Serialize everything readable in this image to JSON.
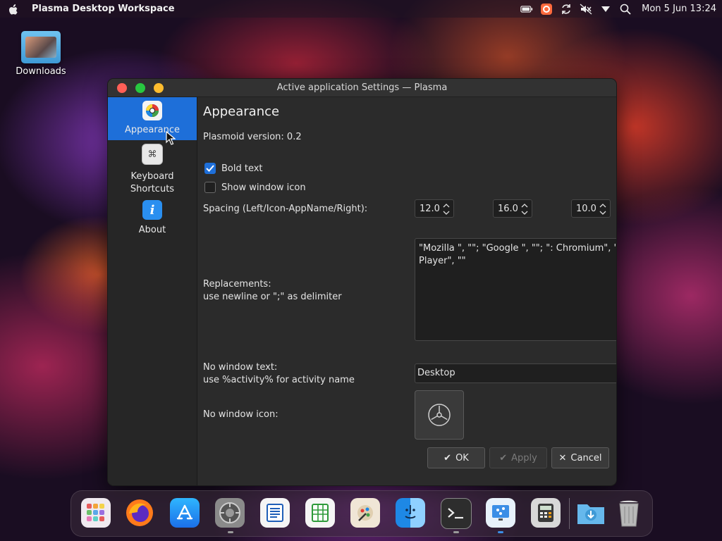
{
  "menubar": {
    "app_title": "Plasma Desktop Workspace",
    "clock": "Mon 5 Jun  13:24",
    "tray_icons": [
      "battery-icon",
      "app-indicator-icon",
      "refresh-icon",
      "mute-icon",
      "dropdown-icon",
      "search-icon"
    ]
  },
  "desktop": {
    "downloads_label": "Downloads"
  },
  "window": {
    "title": "Active application Settings — Plasma",
    "sidebar": {
      "items": [
        {
          "label": "Appearance",
          "icon": "appearance-icon",
          "active": true
        },
        {
          "label_line1": "Keyboard",
          "label_line2": "Shortcuts",
          "icon": "keyboard-icon"
        },
        {
          "label": "About",
          "icon": "info-icon"
        }
      ]
    },
    "appearance": {
      "heading": "Appearance",
      "plasmoid_version": "Plasmoid version: 0.2",
      "bold_text_label": "Bold text",
      "bold_text_checked": true,
      "show_icon_label": "Show window icon",
      "show_icon_checked": false,
      "spacing_label": "Spacing (Left/Icon-AppName/Right):",
      "spacing_left": "12.0",
      "spacing_middle": "16.0",
      "spacing_right": "10.0",
      "replacements_label_line1": "Replacements:",
      "replacements_label_line2": "use newline or \";\" as delimiter",
      "replacements_line1": "\"Mozilla \", \"\"; \"Google \", \"\"; \": Chromium\", \" — (",
      "replacements_line2": "Player\", \"\"",
      "no_window_text_label_line1": "No window text:",
      "no_window_text_label_line2": "use %activity% for activity name",
      "no_window_text_value": "Desktop",
      "no_window_icon_label": "No window icon:"
    },
    "buttons": {
      "ok": "OK",
      "apply": "Apply",
      "cancel": "Cancel"
    }
  },
  "dock": {
    "apps": [
      "launchpad-icon",
      "firefox-icon",
      "app-store-icon",
      "system-settings-icon",
      "writer-icon",
      "calc-spreadsheet-icon",
      "drawing-icon",
      "finder-icon",
      "terminal-icon",
      "sourcetree-icon",
      "calculator-icon",
      "downloads-folder-icon",
      "trash-icon"
    ]
  }
}
